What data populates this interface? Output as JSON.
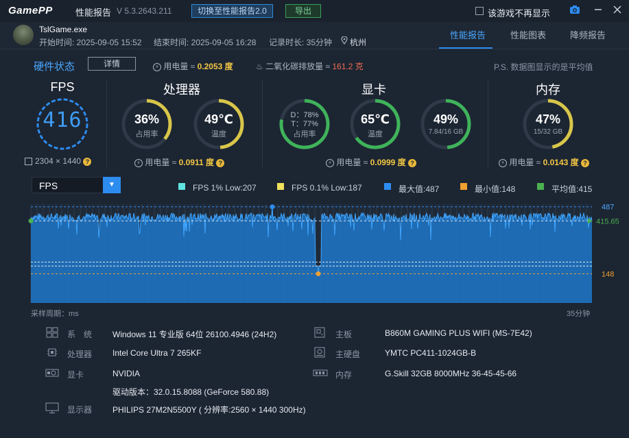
{
  "app": {
    "logo": "GamePP",
    "title": "性能报告",
    "version": "V 5.3.2643.211",
    "switch_label": "切换至性能报告2.0",
    "export_label": "导出",
    "hide_label": "该游戏不再显示"
  },
  "session": {
    "process": "TslGame.exe",
    "start": "开始时间: 2025-09-05 15:52",
    "end": "结束时间: 2025-09-05 16:28",
    "duration": "记录时长: 35分钟",
    "location": "杭州"
  },
  "tabs": [
    "性能报告",
    "性能图表",
    "降频报告"
  ],
  "hardware": {
    "title": "硬件状态",
    "detail_label": "详情",
    "power_text": "用电量 ≈",
    "power_value": "0.2053 度",
    "co2_text": "二氧化碳排放量 ≈",
    "co2_value": "161.2 克",
    "note": "P.S. 数据图显示的是平均值"
  },
  "fps_panel": {
    "title": "FPS",
    "value": "416",
    "resolution": "2304 × 1440",
    "help": "?"
  },
  "cpu_panel": {
    "title": "处理器",
    "usage_value": "36%",
    "usage_label": "占用率",
    "usage_fraction": 0.36,
    "temp_value": "49℃",
    "temp_label": "温度",
    "temp_fraction": 0.49,
    "power_text": "用电量 ≈",
    "power_value": "0.0911 度"
  },
  "gpu_panel": {
    "title": "显卡",
    "d_value": "D：78%",
    "t_value": "T：77%",
    "usage_label": "占用率",
    "usage_fraction": 0.78,
    "temp_value": "65℃",
    "temp_label": "温度",
    "temp_fraction": 0.65,
    "vram_value": "49%",
    "vram_label": "7.84/16 GB",
    "vram_fraction": 0.49,
    "power_text": "用电量 ≈",
    "power_value": "0.0999 度"
  },
  "mem_panel": {
    "title": "内存",
    "value": "47%",
    "label": "15/32 GB",
    "fraction": 0.47,
    "power_text": "用电量 ≈",
    "power_value": "0.0143 度"
  },
  "chart": {
    "metric": "FPS",
    "legend": [
      {
        "label": "FPS 1% Low:207",
        "color": "#5fe3e0"
      },
      {
        "label": "FPS 0.1% Low:187",
        "color": "#f1e15b"
      },
      {
        "label": "最大值:487",
        "color": "#2d8cf0"
      },
      {
        "label": "最小值:148",
        "color": "#f0a030"
      },
      {
        "label": "平均值:415",
        "color": "#4caf50"
      }
    ],
    "max_label": "487",
    "avg_label": "415.65",
    "min_label": "148",
    "x_left_label": "采样周期：ms",
    "x_right_label": "35分钟"
  },
  "chart_data": {
    "type": "area",
    "title": "",
    "xlabel": "采样周期：ms",
    "ylabel": "FPS",
    "ylim": [
      0,
      500
    ],
    "max": 487,
    "min": 148,
    "avg": 415.65,
    "low_1pct": 207,
    "low_01pct": 187,
    "duration_label": "35分钟"
  },
  "sysinfo": {
    "os_label": "系　统",
    "os_value": "Windows 11 专业版 64位 26100.4946 (24H2)",
    "cpu_label": "处理器",
    "cpu_value": "Intel Core Ultra 7 265KF",
    "gpu_label": "显卡",
    "gpu_value": "NVIDIA",
    "driver_value": "驱动版本：32.0.15.8088 (GeForce 580.88)",
    "monitor_label": "显示器",
    "monitor_value": "PHILIPS 27M2N5500Y ( 分辨率:2560 × 1440 300Hz)",
    "mb_label": "主板",
    "mb_value": "B860M GAMING PLUS WIFI (MS-7E42)",
    "disk_label": "主硬盘",
    "disk_value": "YMTC PC411-1024GB-B",
    "mem_label": "内存",
    "mem_value": "G.Skill 32GB 8000MHz 36-45-45-66"
  },
  "colors": {
    "accent": "#2d8cf0",
    "gauge_yellow": "#d8c64a",
    "gauge_green": "#3fb35a",
    "gauge_track": "#2f3a48"
  }
}
